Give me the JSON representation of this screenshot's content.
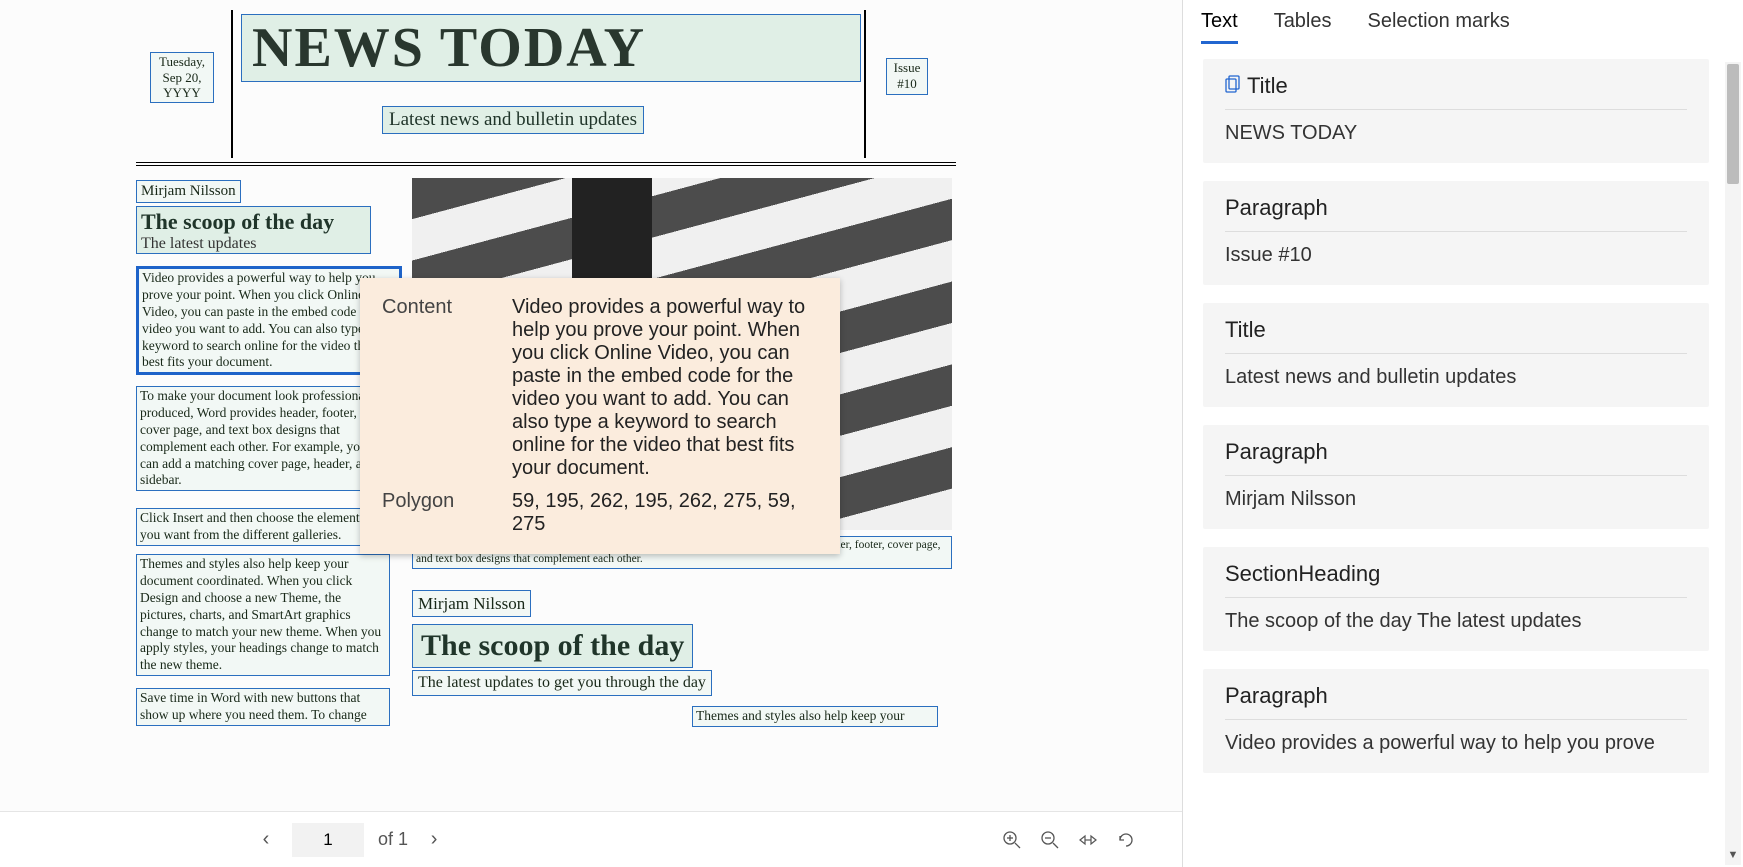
{
  "tabs": {
    "text": "Text",
    "tables": "Tables",
    "selection": "Selection marks"
  },
  "tooltip": {
    "content_label": "Content",
    "content_value": "Video provides a powerful way to help you prove your point. When you click Online Video, you can paste in the embed code for the video you want to add. You can also type a keyword to search online for the video that best fits your document.",
    "polygon_label": "Polygon",
    "polygon_value": "59, 195, 262, 195, 262, 275, 59, 275"
  },
  "pager": {
    "page": "1",
    "of": "of 1"
  },
  "doc": {
    "date": "Tuesday, Sep 20, YYYY",
    "title": "NEWS TODAY",
    "issue": "Issue #10",
    "subtitle": "Latest news and bulletin updates",
    "author1": "Mirjam Nilsson",
    "h1": "The scoop of the day",
    "h1b": "The latest updates",
    "p1": "Video provides a powerful way to help you prove your point. When you click Online Video, you can paste in the embed code for the video you want to add. You can also type a keyword to search online for the video that best fits your document.",
    "p2": "To make your document look professionally produced, Word provides header, footer, cover page, and text box designs that complement each other. For example, you can add a matching cover page, header, and sidebar.",
    "p3": "Click Insert and then choose the elements you want from the different galleries.",
    "p4": "Themes and styles also help keep your document coordinated. When you click Design and choose a new Theme, the pictures, charts, and SmartArt graphics change to match your new theme. When you apply styles, your headings change to match the new theme.",
    "p5": "Save time in Word with new buttons that show up where you need them. To change",
    "caption": "Picture Caption: To make your document look professionally produced, Word provides header, footer, cover page, and text box designs that complement each other.",
    "author2": "Mirjam Nilsson",
    "h2": "The scoop of the day",
    "h2b": "The latest updates to get you through the day",
    "p6": "Themes and styles also help keep your"
  },
  "results": [
    {
      "type": "Title",
      "icon": true,
      "value": "NEWS TODAY"
    },
    {
      "type": "Paragraph",
      "value": "Issue #10"
    },
    {
      "type": "Title",
      "value": "Latest news and bulletin updates"
    },
    {
      "type": "Paragraph",
      "value": "Mirjam Nilsson"
    },
    {
      "type": "SectionHeading",
      "value": "The scoop of the day The latest updates"
    },
    {
      "type": "Paragraph",
      "value": "Video provides a powerful way to help you prove"
    }
  ]
}
